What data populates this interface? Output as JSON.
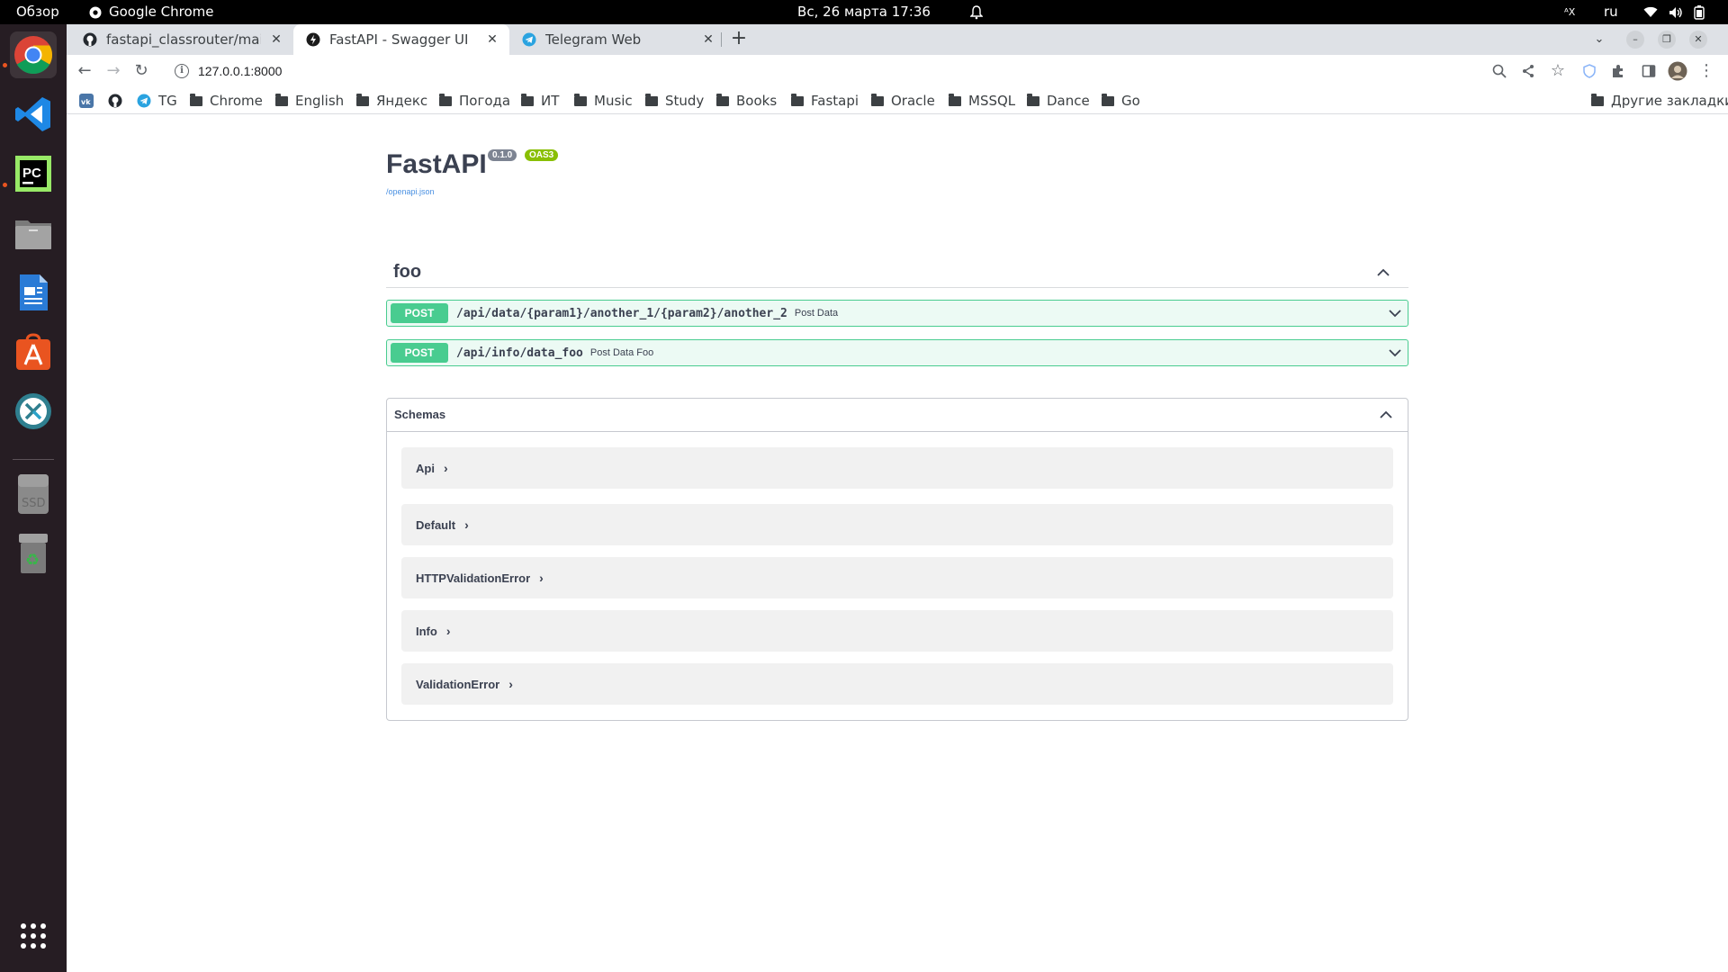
{
  "topbar": {
    "overview": "Обзор",
    "app_name": "Google Chrome",
    "clock": "Вс, 26 марта  17:36",
    "lang": "ru",
    "ax": "ᴬX"
  },
  "browser": {
    "tabs": [
      {
        "title": "fastapi_classrouter/main"
      },
      {
        "title": "FastAPI - Swagger UI"
      },
      {
        "title": "Telegram Web"
      }
    ],
    "url": "127.0.0.1:8000",
    "bookmarks": [
      {
        "label": "TG"
      },
      {
        "label": "Chrome"
      },
      {
        "label": "English"
      },
      {
        "label": "Яндекс"
      },
      {
        "label": "Погода"
      },
      {
        "label": "ИТ"
      },
      {
        "label": "Music"
      },
      {
        "label": "Study"
      },
      {
        "label": "Books"
      },
      {
        "label": "Fastapi"
      },
      {
        "label": "Oracle"
      },
      {
        "label": "MSSQL"
      },
      {
        "label": "Dance"
      },
      {
        "label": "Go"
      }
    ],
    "other_bookmarks": "Другие закладки"
  },
  "swagger": {
    "title": "FastAPI",
    "version": "0.1.0",
    "oas": "OAS3",
    "spec_link": "/openapi.json",
    "tag": "foo",
    "operations": [
      {
        "method": "POST",
        "path": "/api/data/{param1}/another_1/{param2}/another_2",
        "summary": "Post Data"
      },
      {
        "method": "POST",
        "path": "/api/info/data_foo",
        "summary": "Post Data Foo"
      }
    ],
    "schemas_label": "Schemas",
    "models": [
      "Api",
      "Default",
      "HTTPValidationError",
      "Info",
      "ValidationError"
    ]
  },
  "colors": {
    "post": "#49cc90",
    "version_badge": "#7d8492",
    "oas_badge": "#89bf04",
    "dock_bg": "#261d23",
    "tabstrip_bg": "#dee1e6"
  }
}
